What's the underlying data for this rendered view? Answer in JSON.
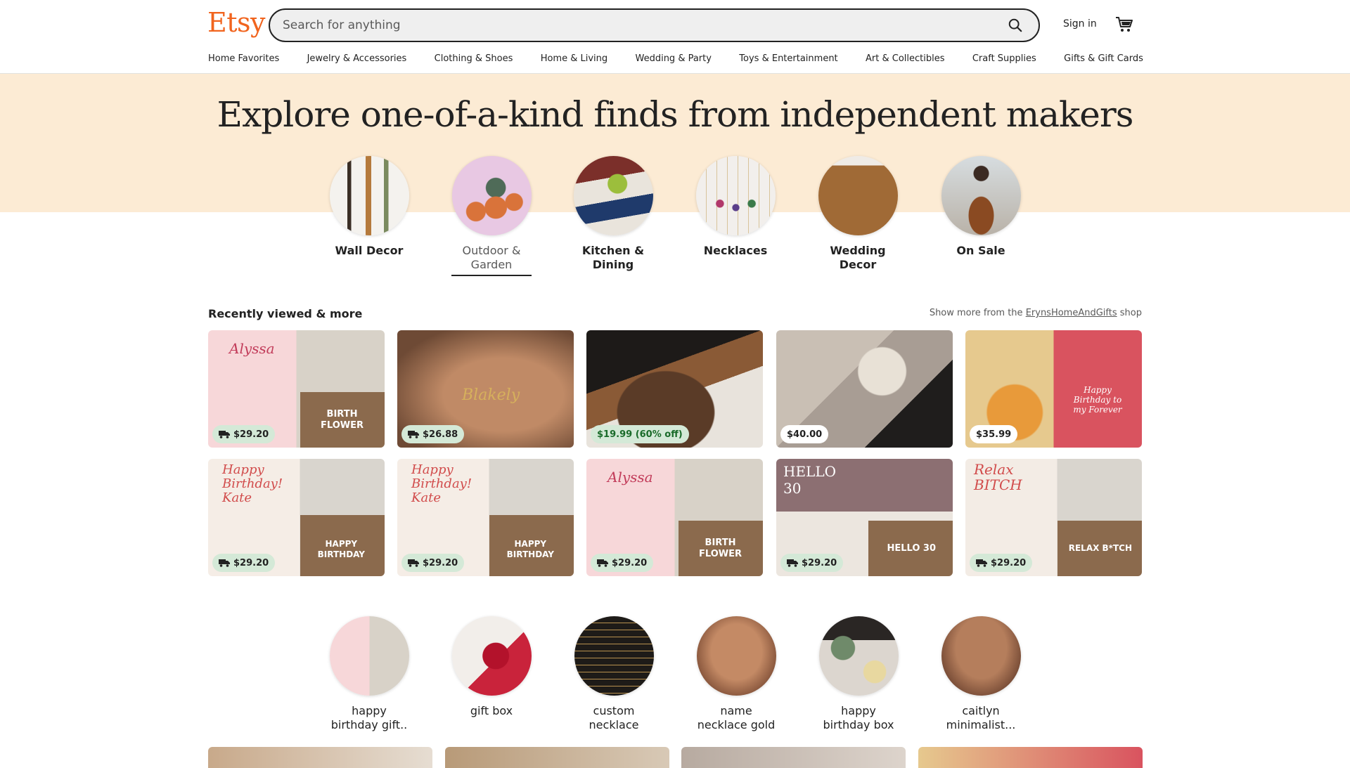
{
  "header": {
    "logo": "Etsy",
    "search_placeholder": "Search for anything",
    "sign_in": "Sign in",
    "cart_icon": "cart-icon"
  },
  "nav": [
    "Home Favorites",
    "Jewelry & Accessories",
    "Clothing & Shoes",
    "Home & Living",
    "Wedding & Party",
    "Toys & Entertainment",
    "Art & Collectibles",
    "Craft Supplies",
    "Gifts & Gift Cards"
  ],
  "hero": {
    "title": "Explore one-of-a-kind finds from independent makers",
    "categories": [
      {
        "label_1": "Wall Decor",
        "label_2": ""
      },
      {
        "label_1": "Outdoor &",
        "label_2": "Garden",
        "active": true
      },
      {
        "label_1": "Kitchen &",
        "label_2": "Dining"
      },
      {
        "label_1": "Necklaces",
        "label_2": ""
      },
      {
        "label_1": "Wedding",
        "label_2": "Decor"
      },
      {
        "label_1": "On Sale",
        "label_2": ""
      }
    ]
  },
  "recent": {
    "title": "Recently viewed & more",
    "show_more_prefix": "Show more from the ",
    "shop_name": "ErynsHomeAndGifts",
    "show_more_suffix": " shop",
    "items": [
      {
        "price": "$29.20",
        "free_shipping": true,
        "image_text_1": "BIRTH",
        "image_text_2": "FLOWER",
        "card_text": "Alyssa"
      },
      {
        "price": "$26.88",
        "free_shipping": true,
        "image_text_1": "",
        "image_text_2": "",
        "card_text": "Blakely"
      },
      {
        "price": "$19.99 (60% off)",
        "free_shipping": false,
        "sale": true,
        "image_text_1": "",
        "image_text_2": "",
        "card_text": ""
      },
      {
        "price": "$40.00",
        "free_shipping": false,
        "image_text_1": "",
        "image_text_2": "",
        "card_text": ""
      },
      {
        "price": "$35.99",
        "free_shipping": false,
        "image_text_1": "",
        "image_text_2": "",
        "card_text": "Happy Birthday to my Forever"
      },
      {
        "price": "$29.20",
        "free_shipping": true,
        "image_text_1": "HAPPY",
        "image_text_2": "BIRTHDAY",
        "card_text": "Happy Birthday! Kate"
      },
      {
        "price": "$29.20",
        "free_shipping": true,
        "image_text_1": "HAPPY",
        "image_text_2": "BIRTHDAY",
        "card_text": "Happy Birthday! Kate"
      },
      {
        "price": "$29.20",
        "free_shipping": true,
        "image_text_1": "BIRTH",
        "image_text_2": "FLOWER",
        "card_text": "Alyssa"
      },
      {
        "price": "$29.20",
        "free_shipping": true,
        "image_text_1": "HELLO 30",
        "image_text_2": "",
        "card_text": "HELLO 30"
      },
      {
        "price": "$29.20",
        "free_shipping": true,
        "image_text_1": "RELAX B*TCH",
        "image_text_2": "",
        "card_text": "Relax BITCH"
      }
    ]
  },
  "related": [
    {
      "label_1": "happy",
      "label_2": "birthday gift.."
    },
    {
      "label_1": "gift box",
      "label_2": ""
    },
    {
      "label_1": "custom",
      "label_2": "necklace"
    },
    {
      "label_1": "name",
      "label_2": "necklace gold"
    },
    {
      "label_1": "happy",
      "label_2": "birthday box"
    },
    {
      "label_1": "caitlyn",
      "label_2": "minimalist..."
    }
  ],
  "colors": {
    "brand": "#f1641e",
    "hero_band": "#fcebd4",
    "shipping_badge": "#d4e9d7",
    "sale_text": "#1a6b2a"
  }
}
